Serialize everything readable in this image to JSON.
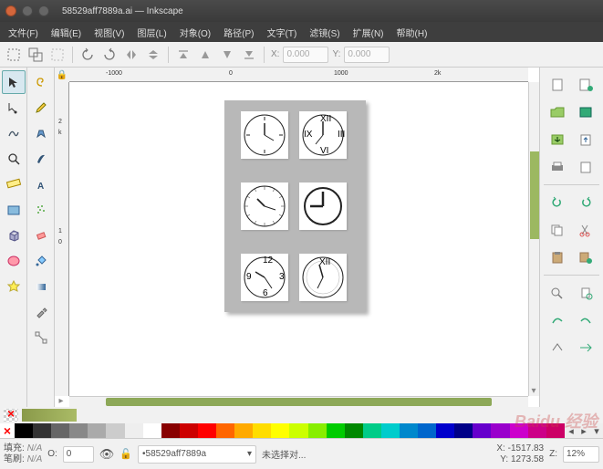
{
  "window": {
    "title": "58529aff7889a.ai — Inkscape"
  },
  "menu": {
    "file": "文件(F)",
    "edit": "编辑(E)",
    "view": "视图(V)",
    "layer": "图层(L)",
    "object": "对象(O)",
    "path": "路径(P)",
    "text": "文字(T)",
    "filter": "滤镜(S)",
    "extension": "扩展(N)",
    "help": "帮助(H)"
  },
  "toolbar": {
    "x_label": "X:",
    "x_val": "0.000",
    "y_label": "Y:",
    "y_val": "0.000"
  },
  "ruler": {
    "neg1000": "-1000",
    "zero": "0",
    "p1000": "1000",
    "p2k": "2k",
    "v2": "2",
    "vk": "k",
    "v1": "1",
    "v0": "0"
  },
  "status": {
    "fill_label": "填充:",
    "stroke_label": "笔刷:",
    "na": "N/A",
    "o_label": "O:",
    "o_val": "0",
    "layer": "•58529aff7889a",
    "sel": "未选择对...",
    "x_label": "X:",
    "x_val": "-1517.83",
    "y_label": "Y:",
    "y_val": "1273.58",
    "z_label": "Z:",
    "z_val": "12%"
  },
  "palette": [
    "#000",
    "#333",
    "#666",
    "#888",
    "#aaa",
    "#ccc",
    "#eee",
    "#fff",
    "#800",
    "#c00",
    "#f00",
    "#f60",
    "#fa0",
    "#fd0",
    "#ff0",
    "#cf0",
    "#8e0",
    "#0c0",
    "#080",
    "#0c8",
    "#0cc",
    "#08c",
    "#06c",
    "#00c",
    "#008",
    "#60c",
    "#90c",
    "#c0c",
    "#c08",
    "#c06"
  ],
  "watermark": "Baidu 经验"
}
